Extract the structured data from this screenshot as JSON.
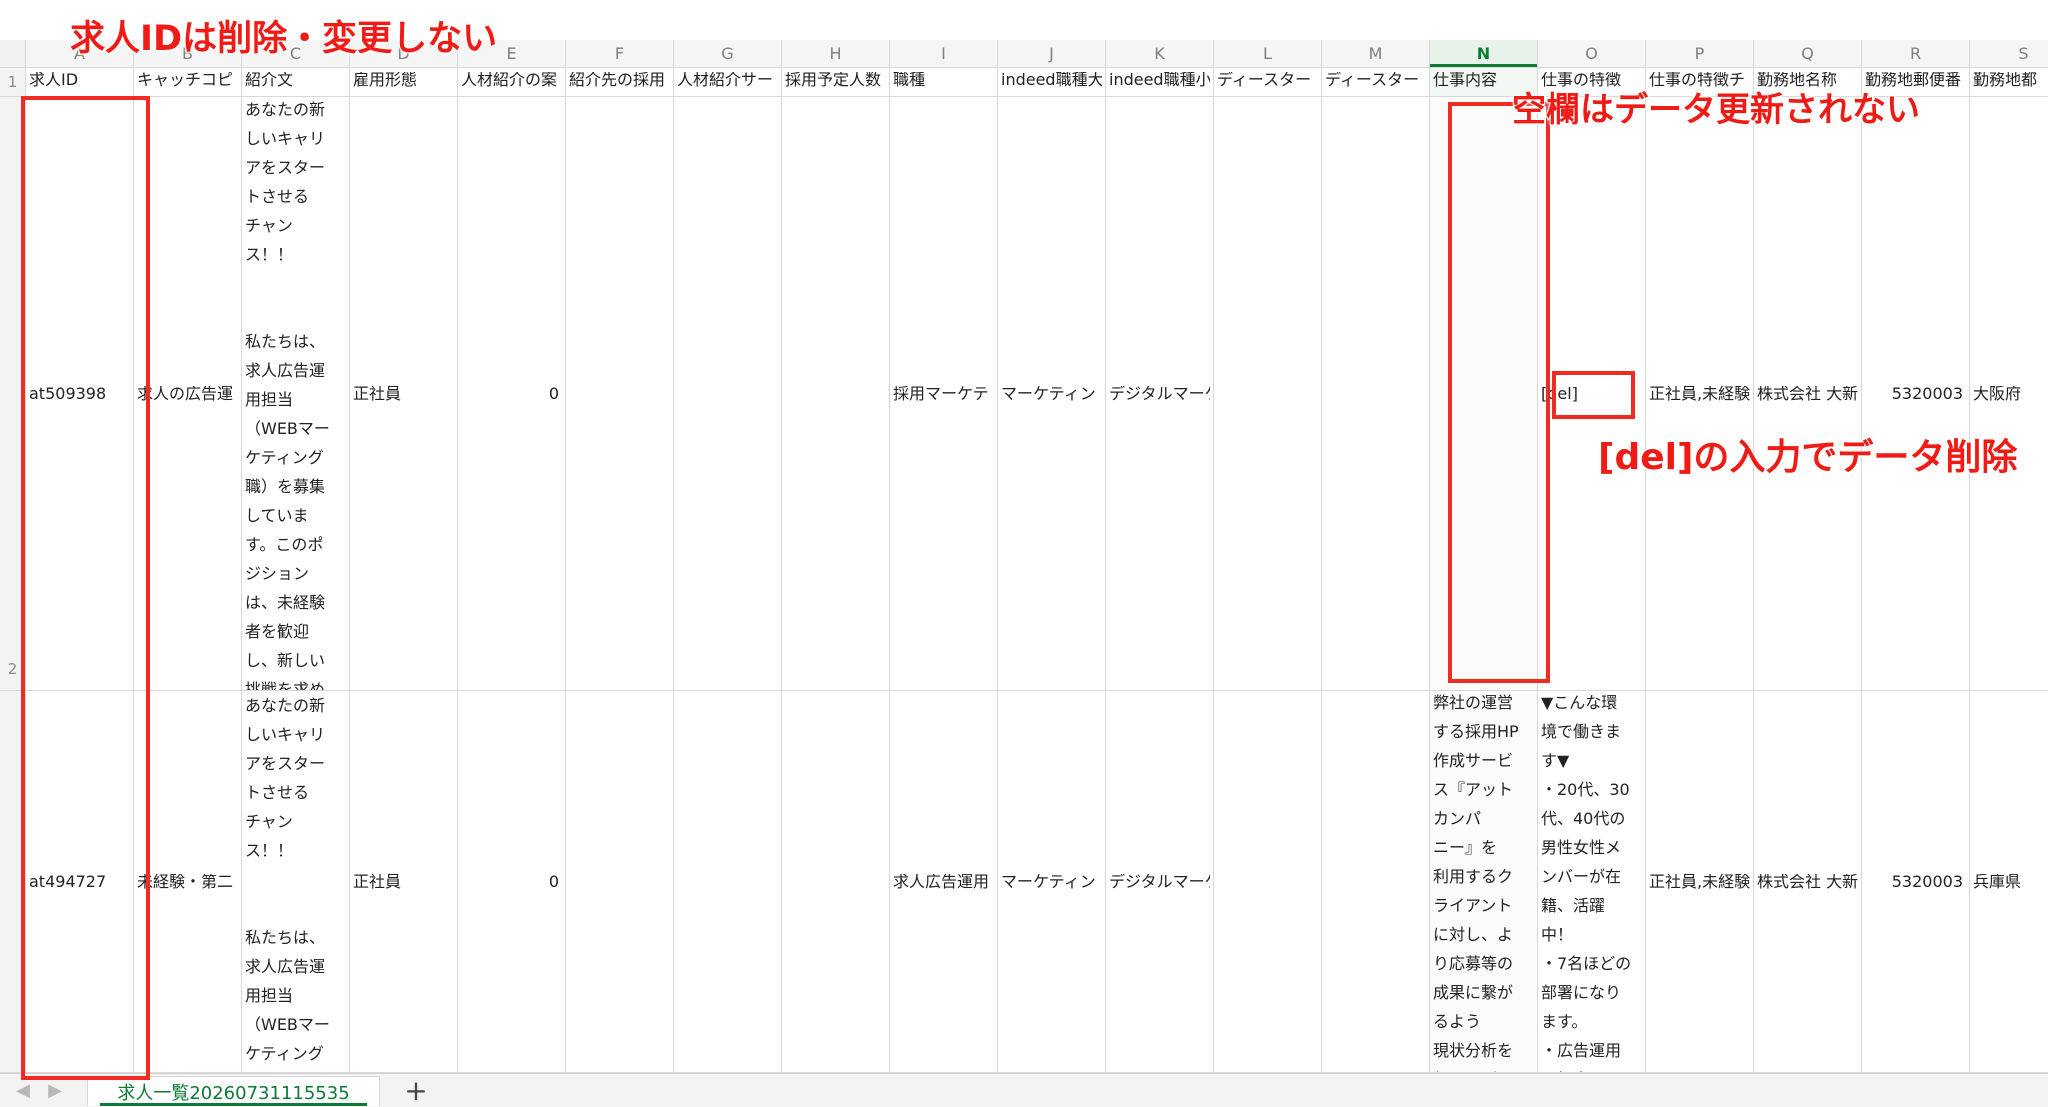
{
  "annotations": {
    "title": "求人IDは削除・変更しない",
    "empty_note": "空欄はデータ更新されない",
    "del_note": "[del]の入力でデータ削除"
  },
  "sheet": {
    "tab_name": "求人一覧20260731115535",
    "add_label": "+"
  },
  "column_letters": [
    "A",
    "B",
    "C",
    "D",
    "E",
    "F",
    "G",
    "H",
    "I",
    "J",
    "K",
    "L",
    "M",
    "N",
    "O",
    "P",
    "Q",
    "R",
    "S"
  ],
  "row_numbers": [
    "1",
    "2"
  ],
  "header_values": [
    "求人ID",
    "キャッチコピ",
    "紹介文",
    "雇用形態",
    "人材紹介の案",
    "紹介先の採用",
    "人材紹介サー",
    "採用予定人数",
    "職種",
    "indeed職種大",
    "indeed職種小",
    "ディースター",
    "ディースター",
    "仕事内容",
    "仕事の特徴",
    "仕事の特徴チ",
    "勤務地名称",
    "勤務地郵便番",
    "勤務地都"
  ],
  "rows": {
    "r2": {
      "a": "at509398",
      "b": "求人の広告運",
      "c": "あなたの新\nしいキャリ\nアをスター\nトさせる\nチャン\nス！！\n\n\n私たちは、\n求人広告運\n用担当\n（WEBマー\nケティング\n職）を募集\nしていま\nす。このポ\nジション\nは、未経験\n者を歓迎\nし、新しい\n挑戦を求め\nる方にぴっ",
      "d": "正社員",
      "e": "0",
      "i": "採用マーケテ",
      "j": "マーケティン",
      "k": "デジタルマーケティング従事者",
      "o": "[del]",
      "p": "正社員,未経験",
      "q": "株式会社 大新",
      "r": "5320003",
      "s": "大阪府"
    },
    "r3": {
      "a": "at494727",
      "b": "未経験・第二",
      "c": "あなたの新\nしいキャリ\nアをスター\nトさせる\nチャン\nス！！\n\n\n私たちは、\n求人広告運\n用担当\n（WEBマー\nケティング\n職）を募集\nしていま",
      "d": "正社員",
      "e": "0",
      "i": "求人広告運用",
      "j": "マーケティン",
      "k": "デジタルマーケティング従事者",
      "n": "弊社の運営\nする採用HP\n作成サービ\nス『アット\nカンパ\nニー』を\n利用するク\nライアント\nに対し、よ\nり応募等の\n成果に繋が\nるよう\n現状分析を\n行いなが",
      "o": "▼こんな環\n境で働きま\nす▼\n・20代、30\n代、40代の\n男性女性メ\nンバーが在\n籍、活躍\n中！\n・7名ほどの\n部署になり\nます。\n・広告運用\nを担当する",
      "p": "正社員,未経験",
      "q": "株式会社 大新",
      "r": "5320003",
      "s": "兵庫県"
    }
  },
  "colors": {
    "accent_green": "#0d7a35",
    "annotation_red": "#ef1b14"
  }
}
